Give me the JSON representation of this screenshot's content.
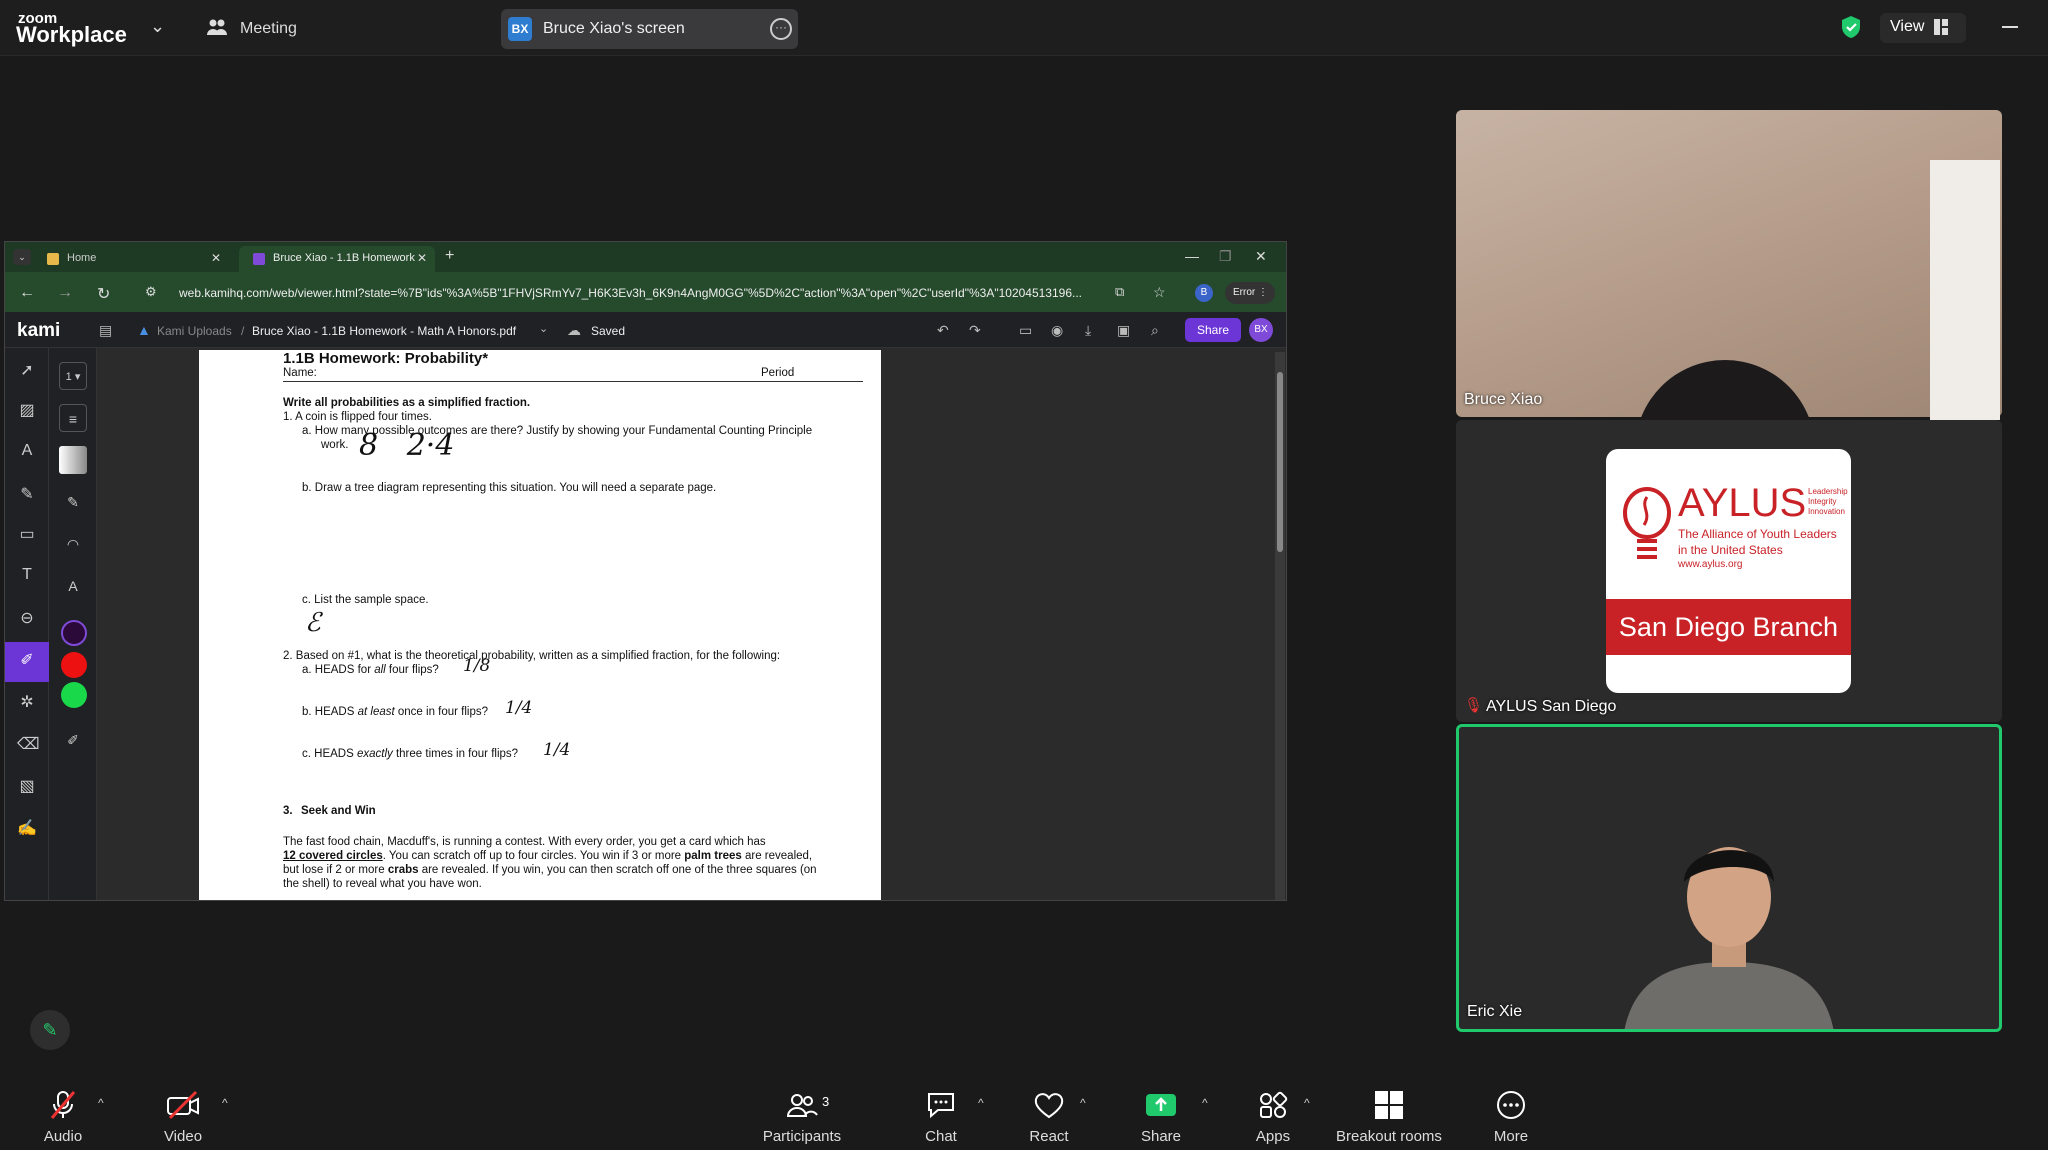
{
  "topbar": {
    "logo_small": "zoom",
    "logo_big": "Workplace",
    "meeting_label": "Meeting",
    "share_badge": "BX",
    "share_label": "Bruce Xiao's screen",
    "view_label": "View",
    "colors": {
      "accent_green": "#20c96b",
      "share_pill": "#3a3a3c"
    }
  },
  "browser": {
    "tabs": [
      {
        "label": "Home"
      },
      {
        "label": "Bruce Xiao - 1.1B Homework"
      }
    ],
    "url": "web.kamihq.com/web/viewer.html?state=%7B\"ids\"%3A%5B\"1FHVjSRmYv7_H6K3Ev3h_6K9n4AngM0GG\"%5D%2C\"action\"%3A\"open\"%2C\"userId\"%3A\"10204513196...",
    "profile_initial": "B",
    "error_label": "Error"
  },
  "kami": {
    "logo": "kami",
    "crumb_root": "Kami Uploads",
    "crumb_sep": "/",
    "file_name": "Bruce Xiao - 1.1B Homework - Math A Honors.pdf",
    "saved_label": "Saved",
    "share_label": "Share",
    "avatar_initials": "BX",
    "page_number": "1"
  },
  "document": {
    "title": "1.1B Homework: Probability*",
    "name_label": "Name:",
    "period_label": "Period",
    "instruction": "Write all probabilities as a simplified fraction.",
    "q1": "1.   A coin is flipped four times.",
    "q1a": "a.   How many possible outcomes are there?  Justify by showing your Fundamental Counting Principle",
    "q1a_work": "work.",
    "q1a_answer": "8   2·4",
    "q1b": "b.   Draw a tree diagram representing this situation.  You will need a separate page.",
    "q1c": "c.   List the sample space.",
    "q1c_answer": "ℰ",
    "q2": "2.   Based on #1, what is the theoretical probability, written as a simplified fraction, for the following:",
    "q2a_pre": "a.   HEADS for ",
    "q2a_em": "all",
    "q2a_post": " four flips?",
    "q2a_answer": "1/8",
    "q2b_pre": "b.   HEADS ",
    "q2b_em": "at least",
    "q2b_post": " once in four flips?",
    "q2b_answer": "1/4",
    "q2c_pre": "c.   HEADS ",
    "q2c_em": "exactly",
    "q2c_post": " three times in four flips?",
    "q2c_answer": "1/4",
    "q3_num": "3.",
    "q3_title": "Seek and Win",
    "p1": "The fast food chain, Macduff's, is running a contest.  With every order, you get a card which has",
    "p2_u": "12 covered circles",
    "p2_a": ".  You can scratch off up to four circles.  You win if 3 or more ",
    "p2_b": "palm trees",
    "p2_c": " are revealed,",
    "p3_a": "but lose if 2 or more ",
    "p3_b": "crabs",
    "p3_c": " are revealed.  If you win, you can then scratch off one of the three squares (on",
    "p4": "the shell) to reveal what you have won."
  },
  "participants_tiles": [
    {
      "name": "Bruce Xiao"
    },
    {
      "name": "AYLUS San Diego",
      "logo_text": "AYLUS",
      "logo_tag1": "Leadership",
      "logo_tag2": "Integrity",
      "logo_tag3": "Innovation",
      "logo_line1": "The Alliance of Youth Leaders",
      "logo_line2": "in the United States",
      "logo_url": "www.aylus.org",
      "banner": "San Diego Branch"
    },
    {
      "name": "Eric Xie"
    }
  ],
  "toolbar": {
    "audio": "Audio",
    "video": "Video",
    "participants": "Participants",
    "participants_count": "3",
    "chat": "Chat",
    "react": "React",
    "share": "Share",
    "apps": "Apps",
    "breakout": "Breakout rooms",
    "more": "More"
  }
}
